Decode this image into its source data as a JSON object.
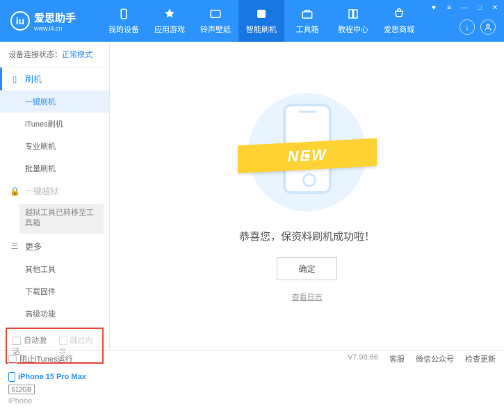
{
  "header": {
    "logo_title": "爱思助手",
    "logo_sub": "www.i4.cn",
    "nav": [
      {
        "label": "我的设备"
      },
      {
        "label": "应用游戏"
      },
      {
        "label": "铃声壁纸"
      },
      {
        "label": "智能刷机"
      },
      {
        "label": "工具箱"
      },
      {
        "label": "教程中心"
      },
      {
        "label": "爱思商城"
      }
    ]
  },
  "sidebar": {
    "status_label": "设备连接状态：",
    "status_value": "正常模式",
    "section_flash": "刷机",
    "items_flash": [
      "一键刷机",
      "iTunes刷机",
      "专业刷机",
      "批量刷机"
    ],
    "section_jail": "一键越狱",
    "jail_note": "越狱工具已转移至工具箱",
    "section_more": "更多",
    "items_more": [
      "其他工具",
      "下载固件",
      "高级功能"
    ],
    "chk_auto": "自动激活",
    "chk_skip": "跳过向导",
    "device_name": "iPhone 15 Pro Max",
    "device_storage": "512GB",
    "device_type": "iPhone"
  },
  "main": {
    "banner": "NEW",
    "success": "恭喜您，保资料刷机成功啦！",
    "ok": "确定",
    "log": "查看日志"
  },
  "footer": {
    "block_itunes": "阻止iTunes运行",
    "version": "V7.98.66",
    "links": [
      "客服",
      "微信公众号",
      "检查更新"
    ]
  }
}
